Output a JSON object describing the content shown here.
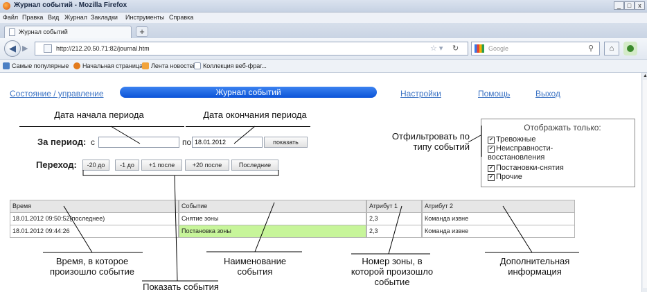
{
  "browser": {
    "title": "Журнал событий - Mozilla Firefox",
    "window_buttons": [
      "_",
      "□",
      "x"
    ],
    "menu": [
      "Файл",
      "Правка",
      "Вид",
      "Журнал",
      "Закладки",
      "Инструменты",
      "Справка"
    ],
    "tab_label": "Журнал событий",
    "new_tab": "+",
    "url": "http://212.20.50.71:82/journal.htm",
    "search_placeholder": "Google",
    "bookmarks": [
      "Самые популярные",
      "Начальная страница",
      "Лента новостей",
      "Коллекция веб-фраг..."
    ]
  },
  "nav": {
    "status": "Состояние / управление",
    "journal": "Журнал событий",
    "settings": "Настройки",
    "help": "Помощь",
    "exit": "Выход"
  },
  "annotations": {
    "start_date": "Дата начала периода",
    "end_date": "Дата окончания периода",
    "filter_by_type": "Отфильтровать по\nтипу событий",
    "time": "Время, в которое\nпроизошло событие",
    "event_name": "Наименование\nсобытия",
    "zone_number": "Номер зоны, в\nкоторой произошло\nсобытие",
    "extra_info": "Дополнительная\nинформация",
    "show_events": "Показать события"
  },
  "form": {
    "period_label": "За период:",
    "from_label": "с",
    "from_value": "",
    "to_label": "по",
    "to_value": "18.01.2012",
    "show_button": "показать",
    "jump_label": "Переход:",
    "jump_buttons": [
      "-20 до",
      "-1 до",
      "+1 после",
      "+20 после",
      "Последние"
    ]
  },
  "filter": {
    "title": "Отображать только:",
    "items": [
      "Тревожные",
      "Неисправности-\nвосстановления",
      "Постановки-снятия",
      "Прочие"
    ],
    "checked": [
      true,
      true,
      true,
      true
    ]
  },
  "table": {
    "headers": [
      "Время",
      "Событие",
      "Атрибут 1",
      "Атрибут 2"
    ],
    "rows": [
      [
        "18.01.2012 09:50:52(последнее)",
        "Снятие зоны",
        "2,3",
        "Команда извне"
      ],
      [
        "18.01.2012 09:44:26",
        "Постановка зоны",
        "2,3",
        "Команда извне"
      ]
    ],
    "highlight_color": "#c7f59a"
  }
}
